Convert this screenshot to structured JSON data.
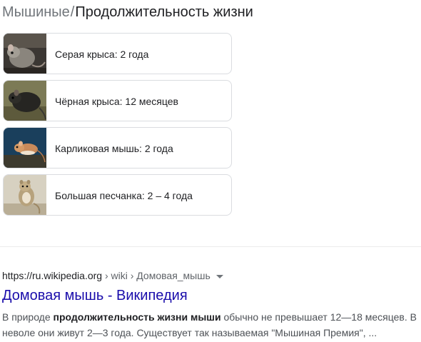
{
  "heading": {
    "category": "Мышиные",
    "separator": "/",
    "title": "Продолжительность жизни"
  },
  "cards": [
    {
      "label": "Серая крыса: 2 года",
      "image_icon": "gray-rat-photo"
    },
    {
      "label": "Чёрная крыса: 12 месяцев",
      "image_icon": "black-rat-photo"
    },
    {
      "label": "Карликовая мышь: 2 года",
      "image_icon": "harvest-mouse-photo"
    },
    {
      "label": "Большая песчанка: 2 – 4 года",
      "image_icon": "great-gerbil-photo"
    }
  ],
  "result": {
    "url_domain": "https://ru.wikipedia.org",
    "url_path": " › wiki › Домовая_мышь",
    "title": "Домовая мышь - Википедия",
    "snippet_parts": [
      {
        "text": "В природе ",
        "bold": false
      },
      {
        "text": "продолжительность жизни мыши",
        "bold": true
      },
      {
        "text": " обычно не превышает 12—18 месяцев. В неволе они живут 2—3 года. Существует так называемая \"Мышиная Премия\", ...",
        "bold": false
      }
    ]
  },
  "colors": {
    "link": "#1a0dab",
    "muted": "#70757a",
    "border": "#dadce0",
    "snippet": "#4d5156"
  }
}
